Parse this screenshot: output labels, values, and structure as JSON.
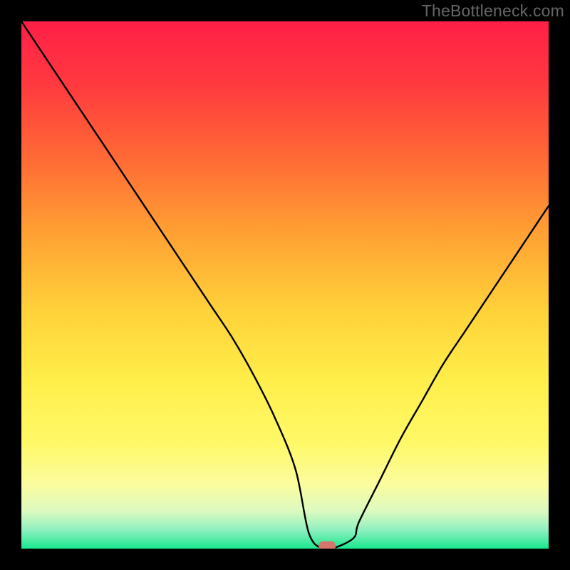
{
  "watermark": "TheBottleneck.com",
  "chart_data": {
    "type": "line",
    "title": "",
    "xlabel": "",
    "ylabel": "",
    "xlim": [
      0,
      100
    ],
    "ylim": [
      0,
      100
    ],
    "legend": false,
    "grid": false,
    "background_gradient": {
      "stops": [
        {
          "offset": 0.0,
          "color": "#ff1f47"
        },
        {
          "offset": 0.12,
          "color": "#ff3a3f"
        },
        {
          "offset": 0.26,
          "color": "#ff6a35"
        },
        {
          "offset": 0.4,
          "color": "#ffa033"
        },
        {
          "offset": 0.55,
          "color": "#ffd23a"
        },
        {
          "offset": 0.68,
          "color": "#ffee4a"
        },
        {
          "offset": 0.8,
          "color": "#fff968"
        },
        {
          "offset": 0.88,
          "color": "#fbfca0"
        },
        {
          "offset": 0.93,
          "color": "#dbfac0"
        },
        {
          "offset": 0.965,
          "color": "#8ef0c0"
        },
        {
          "offset": 1.0,
          "color": "#18e88e"
        }
      ]
    },
    "series": [
      {
        "name": "bottleneck-curve",
        "x": [
          0,
          4,
          8,
          12,
          16,
          20,
          24,
          28,
          32,
          36,
          40,
          44,
          48,
          52,
          54.5,
          57,
          59,
          63,
          64,
          68,
          72,
          76,
          80,
          84,
          88,
          92,
          96,
          100
        ],
        "y": [
          100,
          94,
          88,
          82,
          76,
          70,
          64,
          58,
          52,
          46,
          40,
          33,
          25,
          15,
          3,
          0,
          0,
          2,
          5,
          13,
          21,
          28,
          35,
          41,
          47,
          53,
          59,
          65
        ]
      }
    ],
    "marker": {
      "name": "optimal-marker",
      "x": 58.0,
      "y": 0.5,
      "width_pct": 3.2,
      "height_pct": 1.8,
      "color": "#d6756c"
    }
  }
}
